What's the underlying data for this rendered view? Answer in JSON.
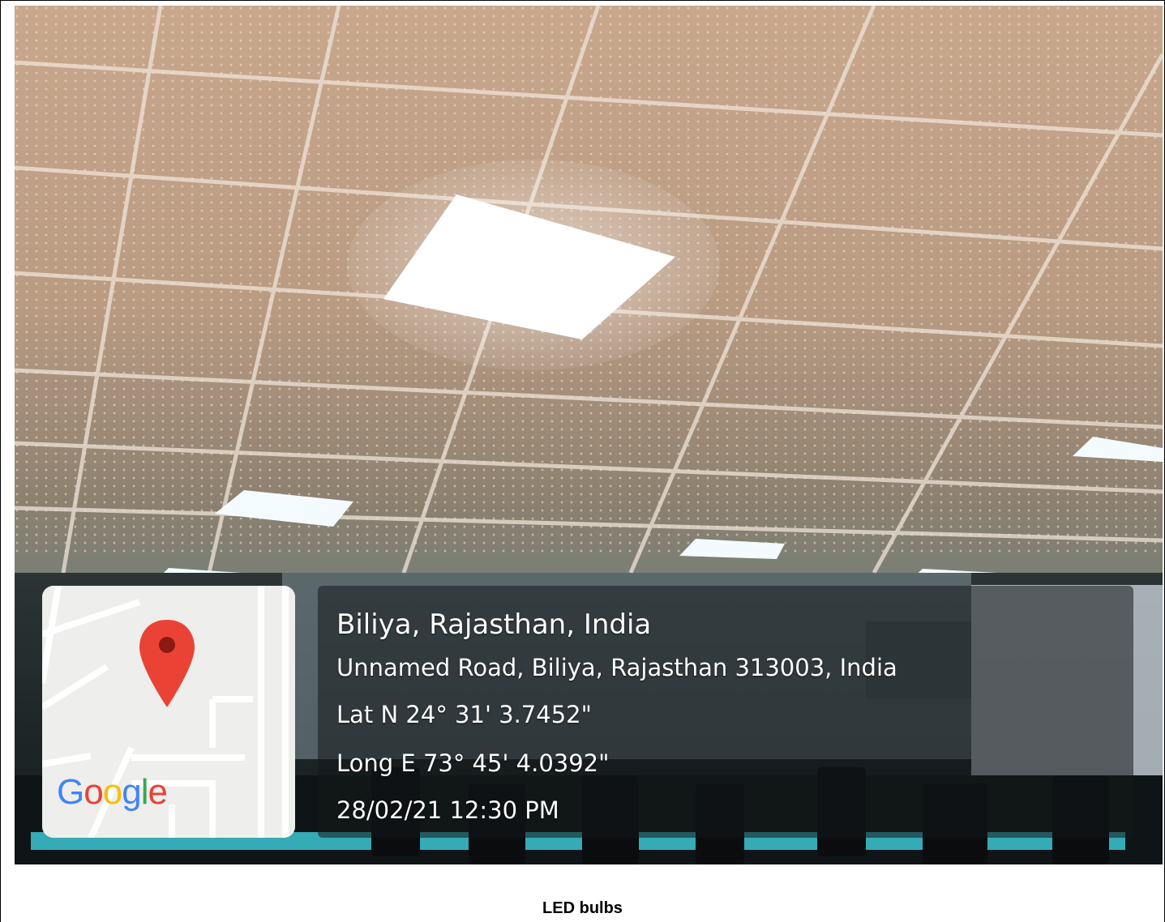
{
  "photo": {
    "subject": "office ceiling with LED panel lights",
    "location_title": "Biliya, Rajasthan, India",
    "address": "Unnamed Road, Biliya, Rajasthan 313003, India",
    "latitude": "Lat N 24° 31' 3.7452\"",
    "longitude": "Long E 73° 45' 4.0392\"",
    "datetime": "28/02/21 12:30 PM"
  },
  "map_thumbnail": {
    "logo_text": "Google",
    "pin_icon": "map-pin-icon",
    "pin_color": "#ea4335"
  },
  "caption": "LED bulbs"
}
